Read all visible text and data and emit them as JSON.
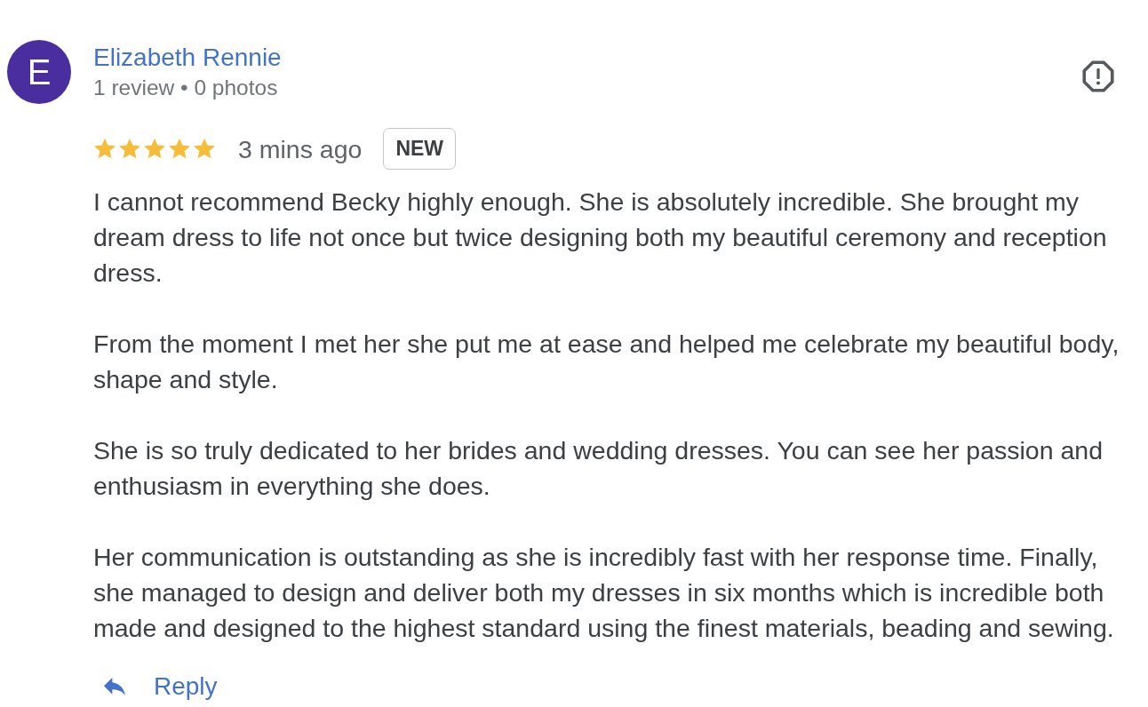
{
  "reviewer": {
    "initial": "E",
    "name": "Elizabeth Rennie",
    "meta": "1 review • 0 photos"
  },
  "rating": {
    "stars": 5,
    "time": "3 mins ago",
    "badge": "NEW"
  },
  "review_text": [
    "I cannot recommend Becky highly enough. She is absolutely incredible. She brought my dream dress to life not once but twice designing both my beautiful ceremony and reception dress.",
    "From the moment I met her she put me at ease and helped me celebrate my beautiful body, shape and style.",
    "She is so truly dedicated to her brides and wedding dresses. You can see her passion and enthusiasm in everything she does.",
    "Her communication is outstanding as she is incredibly fast with her response time. Finally, she managed to design and deliver both my dresses in six months which is incredible both made and designed to the highest standard using the finest materials, beading and sewing."
  ],
  "actions": [
    {
      "label": "Reply"
    }
  ]
}
